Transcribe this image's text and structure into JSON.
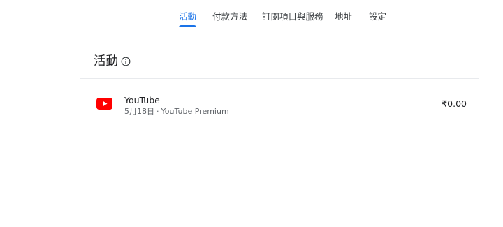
{
  "nav": {
    "tabs": [
      {
        "label": "活動",
        "active": true
      },
      {
        "label": "付款方法",
        "active": false
      },
      {
        "label": "訂閱項目與服務",
        "active": false
      },
      {
        "label": "地址",
        "active": false
      },
      {
        "label": "設定",
        "active": false
      }
    ]
  },
  "section": {
    "title": "活動",
    "info_icon": "info-icon"
  },
  "activity": {
    "items": [
      {
        "icon": "youtube-icon",
        "title": "YouTube",
        "date": "5月18日",
        "separator": "·",
        "product": "YouTube Premium",
        "amount": "₹0.00"
      }
    ]
  },
  "colors": {
    "accent": "#1a73e8",
    "youtube_red": "#ff0000",
    "text_primary": "#202124",
    "text_secondary": "#5f6368",
    "divider": "#e8eaed"
  }
}
